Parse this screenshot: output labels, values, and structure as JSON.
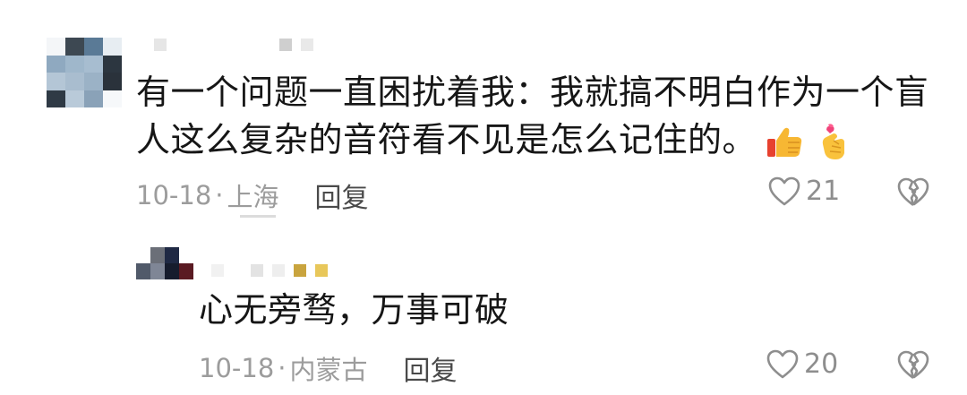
{
  "comment": {
    "text_line1": "有一个问题一直困扰着我：我就搞不明白作为一个盲",
    "text_line2": "人这么复杂的音符看不见是怎么记住的。",
    "emojis": [
      "thumbs-up-icon",
      "finger-heart-icon"
    ],
    "date": "10-18",
    "separator": "·",
    "location": "上海",
    "reply_label": "回复",
    "likes": "21"
  },
  "reply": {
    "text": "心无旁骛，万事可破",
    "date": "10-18",
    "separator": "·",
    "location": "内蒙古",
    "reply_label": "回复",
    "likes": "20"
  },
  "colors": {
    "text": "#161616",
    "meta": "#9c9c9c",
    "reply_button": "#4a4a4a",
    "icon": "#8e8e8e"
  }
}
